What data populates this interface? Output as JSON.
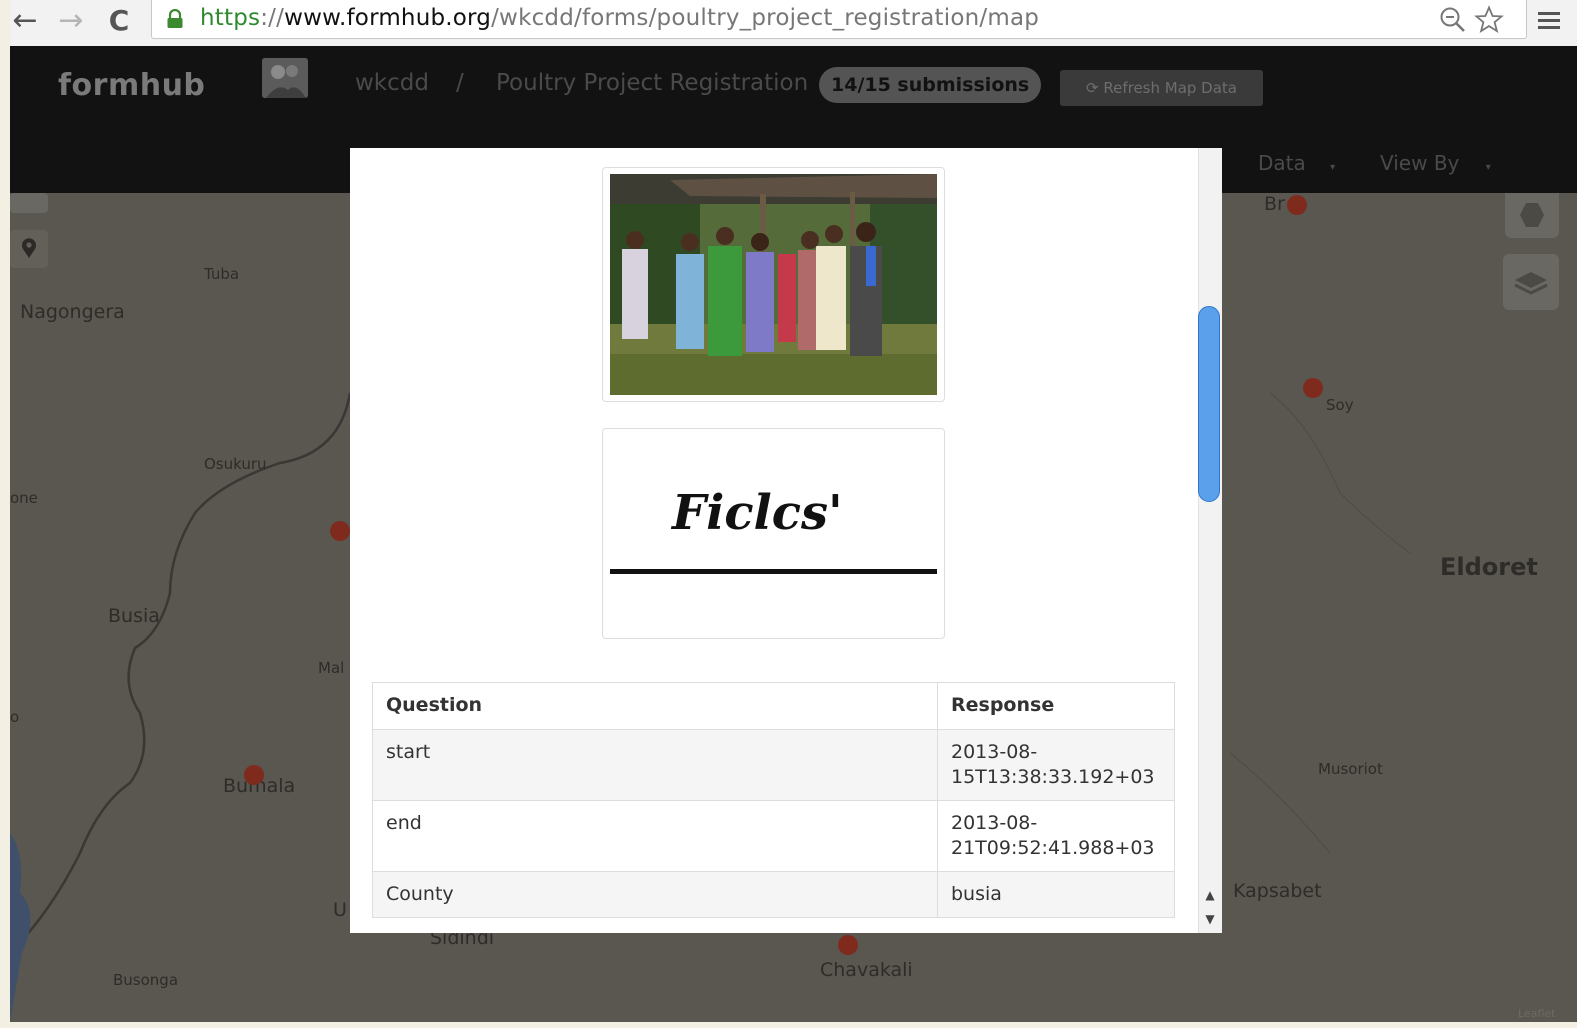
{
  "browser": {
    "url_scheme": "https",
    "url_separator": "://",
    "url_host": "www.formhub.org",
    "url_path": "/wkcdd/forms/poultry_project_registration/map",
    "back_glyph": "←",
    "forward_glyph": "→",
    "reload_glyph": "C",
    "icons": [
      "back-arrow-icon",
      "forward-arrow-icon",
      "reload-icon",
      "lock-icon",
      "zoom-icon",
      "star-icon",
      "menu-icon"
    ]
  },
  "header": {
    "brand": "formhub",
    "user": "wkcdd",
    "separator": "/",
    "form_title": "Poultry Project Registration",
    "submissions_badge": "14/15 submissions",
    "refresh_label": "Refresh Map Data",
    "nav": {
      "data": "Data",
      "view_by": "View By"
    }
  },
  "map": {
    "places": {
      "nagongera": "Nagongera",
      "tuba": "Tuba",
      "osukuru": "Osukuru",
      "one": "one",
      "busia": "Busia",
      "mal": "Mal",
      "bumala": "Bumala",
      "busonga": "Busonga",
      "sidindi": "Sidindi",
      "chavakali": "Chavakali",
      "soy": "Soy",
      "eldoret": "Eldoret",
      "musoriot": "Musoriot",
      "kapsabet": "Kapsabet",
      "broderick": "Br e",
      "u": "U",
      "o": "o",
      "leaflet": "Leaflet"
    },
    "marker_color": "#7e2b1e"
  },
  "modal": {
    "table_headers": {
      "question": "Question",
      "response": "Response"
    },
    "rows": [
      {
        "question": "start",
        "response": "2013-08-15T13:38:33.192+03"
      },
      {
        "question": "end",
        "response": "2013-08-21T09:52:41.988+03"
      },
      {
        "question": "County",
        "response": "busia"
      }
    ],
    "signature_text": "Ficlcs'",
    "scroll_up": "▲",
    "scroll_down": "▼"
  },
  "colors": {
    "accent_scrollbar": "#5aa0ea",
    "secure_green": "#2f8a2f",
    "header_bg": "#121212"
  }
}
